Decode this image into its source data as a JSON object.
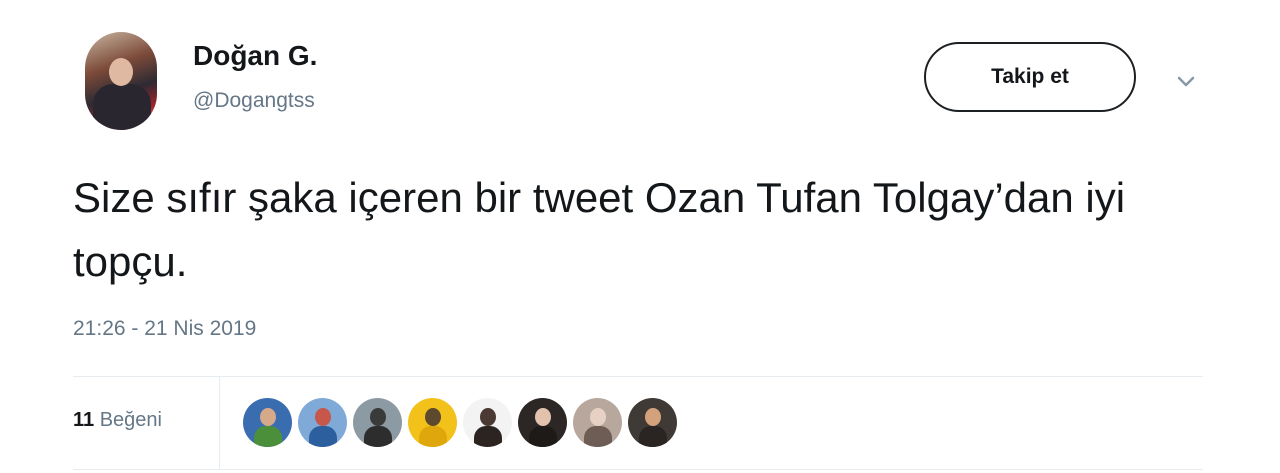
{
  "author": {
    "display_name": "Doğan G.",
    "handle": "@Dogangtss"
  },
  "actions": {
    "follow_label": "Takip et",
    "more_icon": "chevron-down-icon"
  },
  "tweet": {
    "text": "Size sıfır şaka içeren bir tweet Ozan Tufan Tolgay’dan iyi topçu.",
    "timestamp": "21:26 - 21 Nis 2019"
  },
  "stats": {
    "likes_count": "11",
    "likes_label": "Beğeni"
  },
  "likers": [
    {
      "bg": "#3a6db0",
      "head": "#d7a98b",
      "torso": "#4c8f3a"
    },
    {
      "bg": "#7fa9d6",
      "head": "#c7564b",
      "torso": "#2c5f9e"
    },
    {
      "bg": "#8c9aa3",
      "head": "#3a3a3a",
      "torso": "#2d2d2d"
    },
    {
      "bg": "#f2c21b",
      "head": "#5d4a2e",
      "torso": "#e0a70d"
    },
    {
      "bg": "#f3f3f3",
      "head": "#4a3a33",
      "torso": "#2b2420"
    },
    {
      "bg": "#2c2624",
      "head": "#e3c2ad",
      "torso": "#1e1a18"
    },
    {
      "bg": "#b8a79d",
      "head": "#e6d1c4",
      "torso": "#6d5d55"
    },
    {
      "bg": "#3f3a36",
      "head": "#d3a27c",
      "torso": "#2a2522"
    }
  ]
}
